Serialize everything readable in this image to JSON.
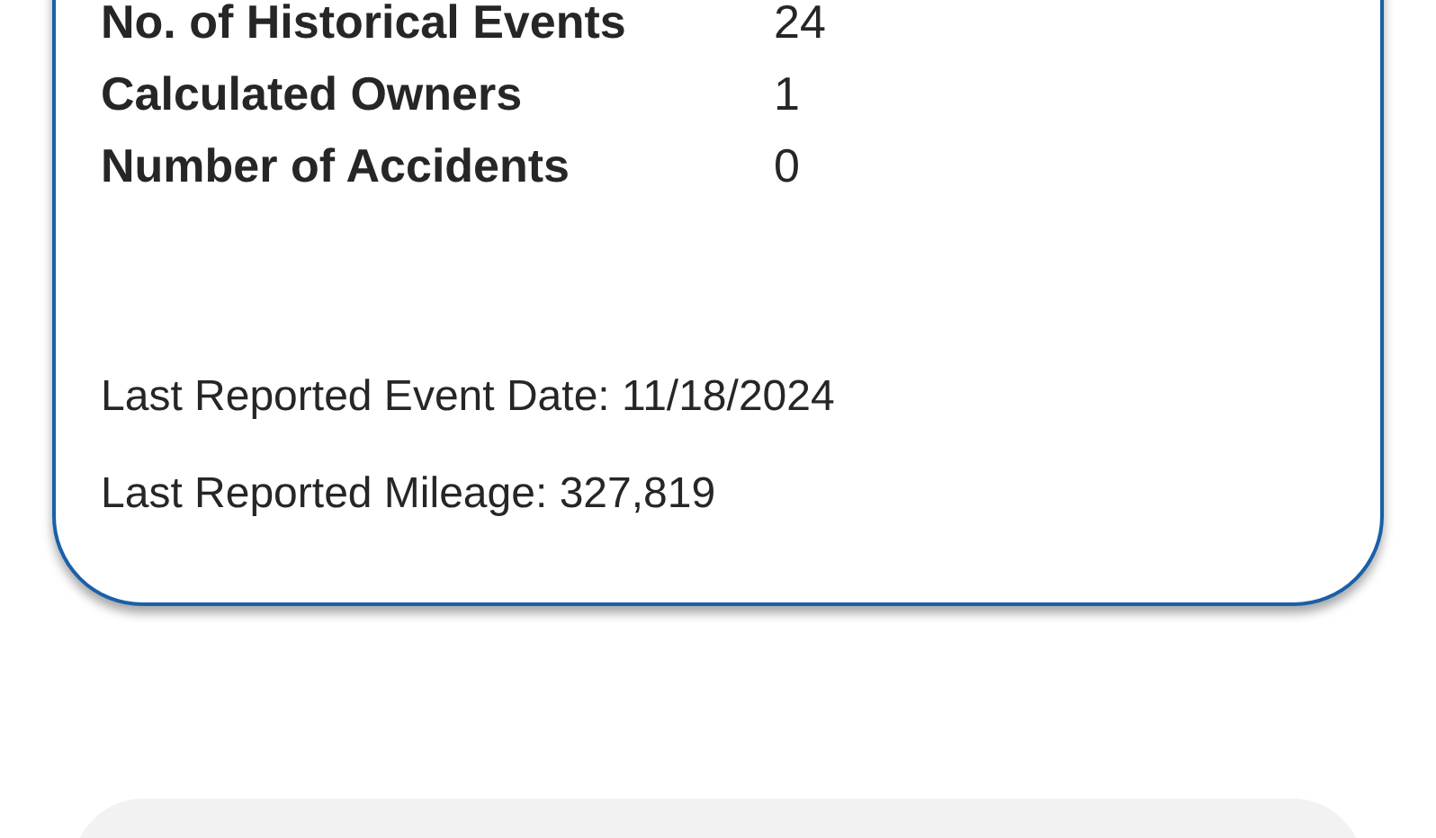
{
  "summary": {
    "rows": [
      {
        "label": "No. of Historical Events",
        "value": "24"
      },
      {
        "label": "Calculated Owners",
        "value": "1"
      },
      {
        "label": "Number of Accidents",
        "value": "0"
      }
    ],
    "last_event_date": "Last Reported Event Date: 11/18/2024",
    "last_mileage": "Last Reported Mileage: 327,819"
  }
}
